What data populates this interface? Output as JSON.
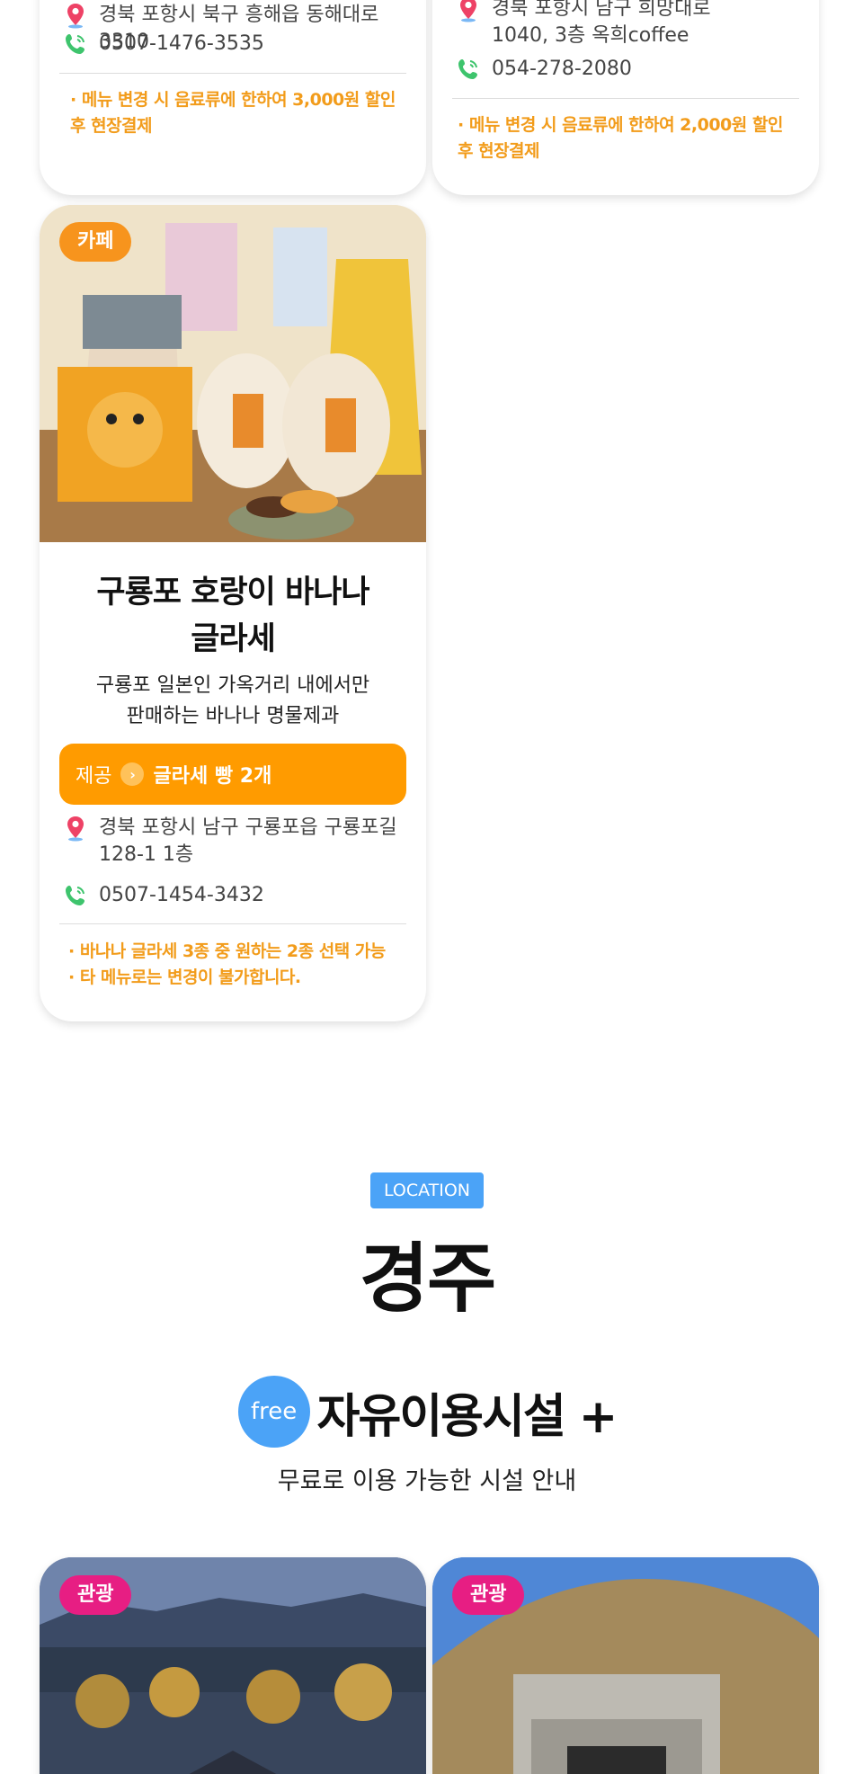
{
  "top_cards": [
    {
      "address": "경북 포항시 북구 흥해읍 동해대로 3310",
      "phone": "0507-1476-3535",
      "note": "· 메뉴 변경 시 음료류에 한하여 3,000원 할인\n  후 현장결제"
    },
    {
      "address": "경북 포항시 남구 희망대로\n1040, 3층 옥희coffee",
      "phone": "054-278-2080",
      "note": "· 메뉴 변경 시 음료류에 한하여 2,000원 할인\n  후 현장결제"
    }
  ],
  "main_card": {
    "badge": "카페",
    "title": "구룡포 호랑이 바나나\n글라세",
    "description": "구룡포 일본인 가옥거리 내에서만\n판매하는 바나나 명물제과",
    "offer_label": "제공",
    "offer_value": "글라세 빵 2개",
    "address": "경북 포항시 남구 구룡포읍 구룡포길\n128-1 1층",
    "phone": "0507-1454-3432",
    "notes": "· 바나나 글라세 3종 중 원하는 2종 선택 가능\n· 타 메뉴로는 변경이 불가합니다."
  },
  "location": {
    "tag": "LOCATION",
    "city": "경주",
    "free_badge": "free",
    "free_title": "자유이용시설 +",
    "free_subtitle": "무료로 이용 가능한 시설 안내"
  },
  "bottom_cards": [
    {
      "badge": "관광"
    },
    {
      "badge": "관광"
    }
  ],
  "colors": {
    "accent_orange": "#ff9b00",
    "note_orange": "#f29c1b",
    "badge_pink": "#e71e83",
    "location_blue": "#4ba3f7"
  },
  "icons": [
    "map-pin-icon",
    "phone-icon",
    "chevron-right-icon"
  ]
}
